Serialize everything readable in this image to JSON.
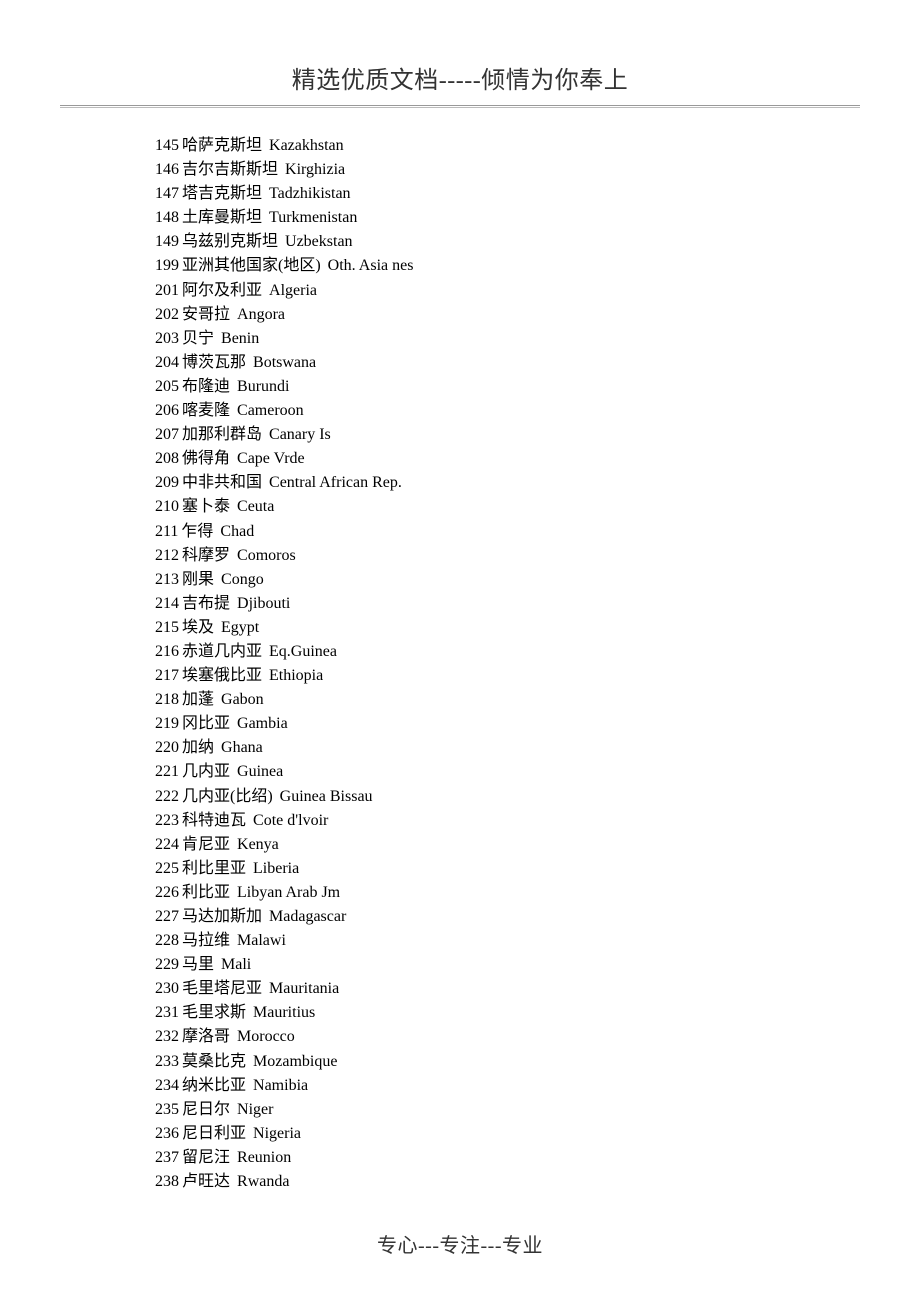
{
  "header": "精选优质文档-----倾情为你奉上",
  "footer": "专心---专注---专业",
  "entries": [
    {
      "code": "145",
      "cn": "哈萨克斯坦",
      "en": "Kazakhstan"
    },
    {
      "code": "146",
      "cn": "吉尔吉斯斯坦",
      "en": "Kirghizia"
    },
    {
      "code": "147",
      "cn": "塔吉克斯坦",
      "en": "Tadzhikistan"
    },
    {
      "code": "148",
      "cn": "土库曼斯坦",
      "en": "Turkmenistan"
    },
    {
      "code": "149",
      "cn": "乌兹别克斯坦",
      "en": "Uzbekstan"
    },
    {
      "code": "199",
      "cn": "亚洲其他国家(地区)",
      "en": "Oth. Asia nes"
    },
    {
      "code": "201",
      "cn": "阿尔及利亚",
      "en": "Algeria"
    },
    {
      "code": "202",
      "cn": "安哥拉",
      "en": "Angora"
    },
    {
      "code": "203",
      "cn": "贝宁",
      "en": "Benin"
    },
    {
      "code": "204",
      "cn": "博茨瓦那",
      "en": "Botswana"
    },
    {
      "code": "205",
      "cn": "布隆迪",
      "en": "Burundi"
    },
    {
      "code": "206",
      "cn": "喀麦隆",
      "en": "Cameroon"
    },
    {
      "code": "207",
      "cn": "加那利群岛",
      "en": "Canary Is"
    },
    {
      "code": "208",
      "cn": "佛得角",
      "en": "Cape Vrde"
    },
    {
      "code": "209",
      "cn": "中非共和国",
      "en": "Central African Rep."
    },
    {
      "code": "210",
      "cn": "塞卜泰",
      "en": "Ceuta"
    },
    {
      "code": "211",
      "cn": "乍得",
      "en": "Chad"
    },
    {
      "code": "212",
      "cn": "科摩罗",
      "en": "Comoros"
    },
    {
      "code": "213",
      "cn": "刚果",
      "en": "Congo"
    },
    {
      "code": "214",
      "cn": "吉布提",
      "en": "Djibouti"
    },
    {
      "code": "215",
      "cn": "埃及",
      "en": "Egypt"
    },
    {
      "code": "216",
      "cn": "赤道几内亚",
      "en": "Eq.Guinea"
    },
    {
      "code": "217",
      "cn": "埃塞俄比亚",
      "en": "Ethiopia"
    },
    {
      "code": "218",
      "cn": "加蓬",
      "en": "Gabon"
    },
    {
      "code": "219",
      "cn": "冈比亚",
      "en": "Gambia"
    },
    {
      "code": "220",
      "cn": "加纳",
      "en": "Ghana"
    },
    {
      "code": "221",
      "cn": "几内亚",
      "en": "Guinea"
    },
    {
      "code": "222",
      "cn": "几内亚(比绍)",
      "en": "Guinea Bissau"
    },
    {
      "code": "223",
      "cn": "科特迪瓦",
      "en": "Cote d'lvoir"
    },
    {
      "code": "224",
      "cn": "肯尼亚",
      "en": "Kenya"
    },
    {
      "code": "225",
      "cn": "利比里亚",
      "en": "Liberia"
    },
    {
      "code": "226",
      "cn": "利比亚",
      "en": "Libyan Arab Jm"
    },
    {
      "code": "227",
      "cn": "马达加斯加",
      "en": "Madagascar"
    },
    {
      "code": "228",
      "cn": "马拉维",
      "en": "Malawi"
    },
    {
      "code": "229",
      "cn": "马里",
      "en": "Mali"
    },
    {
      "code": "230",
      "cn": "毛里塔尼亚",
      "en": "Mauritania"
    },
    {
      "code": "231",
      "cn": "毛里求斯",
      "en": "Mauritius"
    },
    {
      "code": "232",
      "cn": "摩洛哥",
      "en": "Morocco"
    },
    {
      "code": "233",
      "cn": "莫桑比克",
      "en": "Mozambique"
    },
    {
      "code": "234",
      "cn": "纳米比亚",
      "en": "Namibia"
    },
    {
      "code": "235",
      "cn": "尼日尔",
      "en": "Niger"
    },
    {
      "code": "236",
      "cn": "尼日利亚",
      "en": "Nigeria"
    },
    {
      "code": "237",
      "cn": "留尼汪",
      "en": "Reunion"
    },
    {
      "code": "238",
      "cn": "卢旺达",
      "en": "Rwanda"
    }
  ]
}
